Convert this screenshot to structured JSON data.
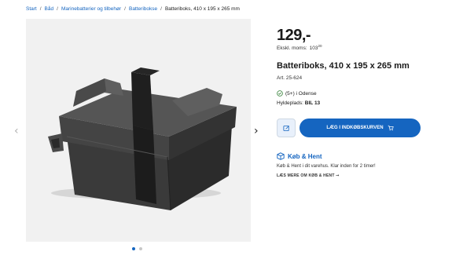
{
  "breadcrumb": {
    "items": [
      "Start",
      "Båd",
      "Marinebatterier og tilbehør",
      "Batteribokse"
    ],
    "separator": "/",
    "current": "Batteriboks, 410 x 195 x 265 mm"
  },
  "gallery": {
    "prev_icon": "chevron-left-icon",
    "next_icon": "chevron-right-icon",
    "prev_glyph": "‹",
    "next_glyph": "›",
    "image_count": 2,
    "active_index": 0
  },
  "product": {
    "price": "129,-",
    "excl_label": "Ekskl. moms:",
    "excl_value": "103",
    "excl_decimals": "20",
    "title": "Batteriboks, 410 x 195 x 265 mm",
    "article": "Art. 25-624",
    "stock": "(5+) i Odense",
    "shelf_label": "Hyldeplads:",
    "shelf_value": "BIL 13"
  },
  "actions": {
    "cart_label": "LÆG I INDKØBSKURVEN",
    "wishlist_icon": "edit-list-icon",
    "cart_icon": "cart-icon"
  },
  "click_collect": {
    "title": "Køb & Hent",
    "description": "Køb & Hent i dit varehus. Klar inden for 2 timer!",
    "more_link": "LÆS MERE OM KØB & HENT"
  },
  "colors": {
    "accent": "#1565c0",
    "stock_green": "#2e7d32",
    "gallery_bg": "#f1f1f1"
  }
}
